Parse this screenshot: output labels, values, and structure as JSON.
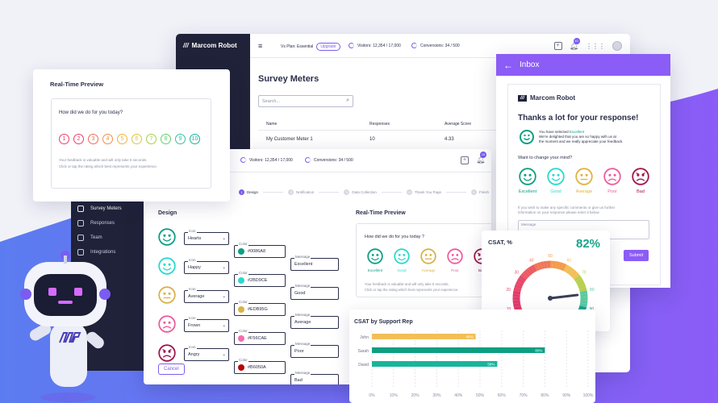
{
  "app": {
    "brand": "Marcom Robot",
    "plan_label": "Vs Plan: Essential",
    "upgrade": "Upgrade",
    "visitors": "Visitors: 12,354 / 17,000",
    "conversions": "Conversions: 34 / 500",
    "notif_count": "10",
    "page_title": "Survey Meters",
    "search_placeholder": "Search...",
    "table": {
      "headers": [
        "Name",
        "Responses",
        "Average Score"
      ],
      "rows": [
        [
          "My Customer Meter 1",
          "10",
          "4.33"
        ]
      ]
    },
    "nav": [
      {
        "label": "Survey Meters"
      },
      {
        "label": "Responses"
      },
      {
        "label": "Team"
      },
      {
        "label": "Integrations"
      }
    ]
  },
  "app2": {
    "visitors": "Visitors: 12,354 / 17,000",
    "conversions": "Conversions: 34 / 500",
    "notif_count": "10",
    "steps": [
      "Design",
      "Notification",
      "Data Collection",
      "Thank You Page",
      "Finish"
    ],
    "design_title": "Design",
    "rows": [
      {
        "icon": "Hearts",
        "color": "#0086A8",
        "message": "Excellent",
        "dot": "#0e9f83",
        "face": "#0e9f83"
      },
      {
        "icon": "Happy",
        "color": "#2BD9CE",
        "message": "Good",
        "dot": "#2bd9ce",
        "face": "#2bd9ce"
      },
      {
        "icon": "Average",
        "color": "#EDB95G",
        "message": "Average",
        "dot": "#d8b24a",
        "face": "#d8b24a"
      },
      {
        "icon": "Frown",
        "color": "#F56CAE",
        "message": "Poor",
        "dot": "#f56cae",
        "face": "#ee5c9e"
      },
      {
        "icon": "Angry",
        "color": "#B6050A",
        "message": "Bad",
        "dot": "#b6050a",
        "face": "#a0174a"
      }
    ],
    "icon_label": "Icon",
    "color_label": "Color",
    "message_label": "Message",
    "cancel": "Cancel",
    "preview_title": "Real-Time Preview",
    "preview_question": "How did we do for you today ?",
    "preview_faces": [
      "Excellent",
      "Good",
      "Average",
      "Poor",
      "Bad"
    ],
    "preview_note": "Your feedback is valuable and will only take 5 seconds.",
    "preview_note2": "Click or tap the rating which best represents your experience."
  },
  "preview": {
    "title": "Real-Time Preview",
    "question": "How did we do for you today?",
    "numbers": [
      "1",
      "2",
      "3",
      "4",
      "5",
      "6",
      "7",
      "8",
      "9",
      "10"
    ],
    "note": "Your feedback is valuable and will only take 5 seconds.",
    "note2": "Click or tap the rating which best represents your experience."
  },
  "inbox": {
    "title": "Inbox",
    "brand": "Marcom Robot",
    "thanks": "Thanks a lot for your response!",
    "selected_prefix": "You have selected",
    "selected": "Excellent",
    "msg1": "We're delighted that you are so happy with us at",
    "msg2": "the moment and we really appreciate your feedback.",
    "change": "Want to change your mind?",
    "faces": [
      "Excellent",
      "Good",
      "Average",
      "Poor",
      "Bad"
    ],
    "more1": "If you wish to make any specific comments or give us further",
    "more2": "information on your response please enter it below",
    "message_label": "Message",
    "submit": "Submit"
  },
  "csat": {
    "title": "CSAT, %",
    "value": "82%",
    "ticks": [
      "0",
      "10",
      "20",
      "30",
      "40",
      "50",
      "60",
      "70",
      "80",
      "90",
      "100"
    ],
    "gauge_value": 82
  },
  "bars": {
    "title": "CSAT by Support Rep",
    "chart_data": {
      "type": "bar",
      "categories": [
        "John",
        "Sarah",
        "David"
      ],
      "values": [
        48,
        80,
        58
      ],
      "colors": [
        "#f2bf57",
        "#0e9f83",
        "#18b59b"
      ],
      "labels": [
        "48%",
        "80%",
        "58%"
      ],
      "xticks": [
        "0%",
        "10%",
        "20%",
        "30%",
        "40%",
        "50%",
        "60%",
        "70%",
        "80%",
        "90%",
        "100%"
      ],
      "xlim": [
        0,
        100
      ]
    }
  }
}
